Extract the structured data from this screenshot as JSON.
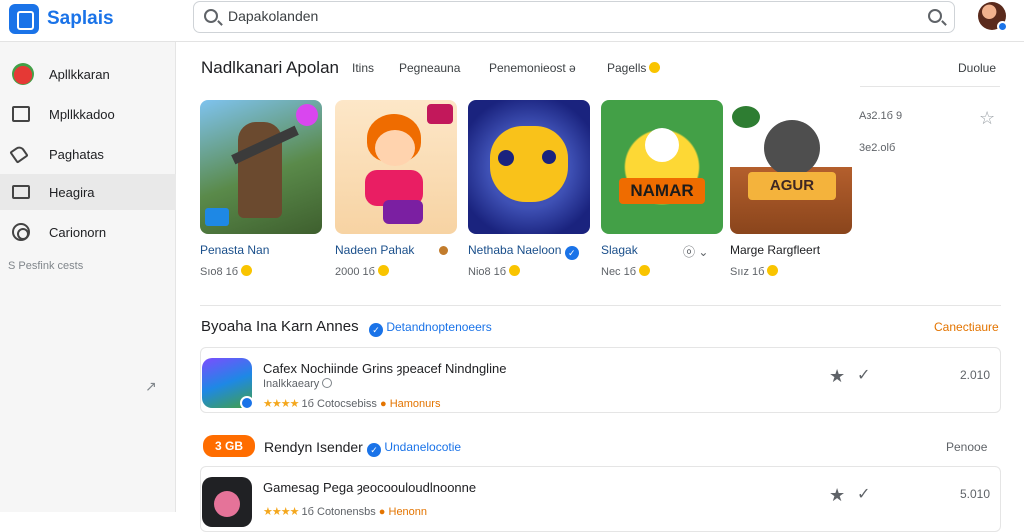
{
  "app": {
    "name": "Saplais"
  },
  "search": {
    "value": "Dapakolanden"
  },
  "sidebar": {
    "items": [
      {
        "label": "Apllkkaran",
        "icon": "apple-icon"
      },
      {
        "label": "Mpllkkadoo",
        "icon": "document-icon"
      },
      {
        "label": "Paghatas",
        "icon": "tag-icon"
      },
      {
        "label": "Heagira",
        "icon": "bag-icon",
        "active": true
      },
      {
        "label": "Carionorn",
        "icon": "ring-icon"
      }
    ],
    "sub_label": "S Pesfink cests"
  },
  "featured": {
    "title": "Nadlkanari Apolan",
    "tabs": [
      "Itins",
      "Pegneauna",
      "Penemonieost ə",
      "Pagells"
    ],
    "see_all": "Duolue",
    "cards": [
      {
        "title": "Penasta Nan",
        "meta": "Sıo8 1б"
      },
      {
        "title": "Nadeen Pahak",
        "meta": "2000 1б"
      },
      {
        "title": "Nethaba Naeloon",
        "meta": "Nio8 1б"
      },
      {
        "title": "Slagak",
        "meta": "Nec 1б"
      },
      {
        "title": "Marge Rargfleert",
        "meta": "Sıız 1б"
      }
    ],
    "side_stats": [
      "Aз2.1б 9",
      "3e2.olб"
    ]
  },
  "list_section": {
    "title": "Byoaha Ina Karn Annes",
    "badge_label": "Detandnoptenoeers",
    "see_all": "Canectiaure",
    "rows": [
      {
        "title": "Cafex Nochiinde Grins ȝpeacef Nindngline",
        "subtitle": "Inalkkaeary",
        "stars": "★★★★",
        "rating": "1б",
        "rating_text": "Cotocsebiss",
        "tag": "Hamonurs",
        "price": "2.010"
      },
      {
        "title": "Gamesag Pega ȝeocoouloudlnoonne",
        "subtitle": "",
        "stars": "★★★★",
        "rating": "1б",
        "rating_text": "Cotonensbs",
        "tag": "Henonn",
        "price": "5.010"
      }
    ]
  },
  "promo": {
    "badge": "3 GB",
    "title": "Rendyn Isender",
    "link": "Undanelocotie",
    "see_all": "Penooe"
  }
}
